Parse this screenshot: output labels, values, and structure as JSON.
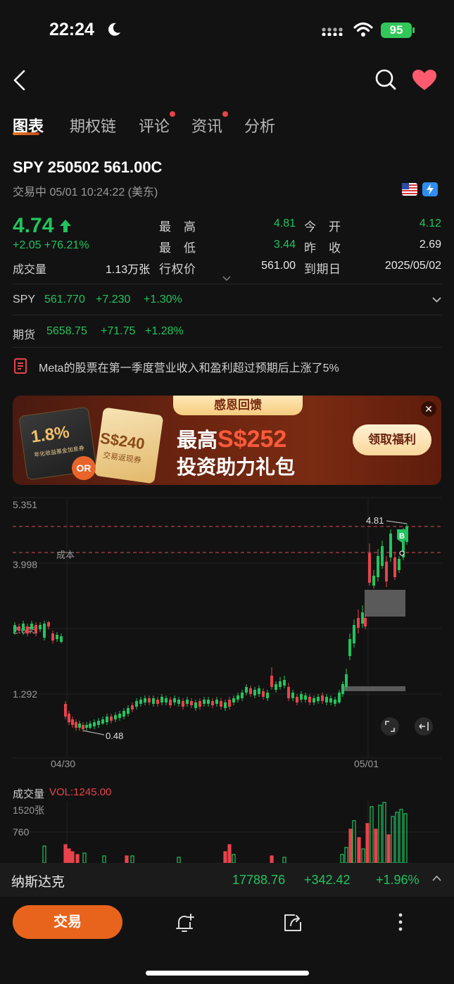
{
  "status_bar": {
    "time": "22:24",
    "battery": "95"
  },
  "tabs": [
    {
      "label": "图表",
      "active": true,
      "dot": false
    },
    {
      "label": "期权链",
      "active": false,
      "dot": false
    },
    {
      "label": "评论",
      "active": false,
      "dot": true
    },
    {
      "label": "资讯",
      "active": false,
      "dot": true
    },
    {
      "label": "分析",
      "active": false,
      "dot": false
    }
  ],
  "header": {
    "symbol": "SPY 250502 561.00C",
    "trade_status": "交易中 05/01 10:24:22 (美东)",
    "price": "4.74",
    "change": "+2.05 +76.21%",
    "volume_label": "成交量",
    "volume_value": "1.13万张"
  },
  "stats": {
    "high_label": "最　高",
    "high": "4.81",
    "open_label": "今　开",
    "open": "4.12",
    "low_label": "最　低",
    "low": "3.44",
    "prev_close_label": "昨　收",
    "prev_close": "2.69",
    "strike_label": "行权价",
    "strike": "561.00",
    "expiry_label": "到期日",
    "expiry": "2025/05/02"
  },
  "underlying": {
    "label": "SPY",
    "price": "561.770",
    "change": "+7.230",
    "pct": "+1.30%"
  },
  "futures": {
    "label": "期货",
    "price": "5658.75",
    "change": "+71.75",
    "pct": "+1.28%"
  },
  "news": {
    "text": "Meta的股票在第一季度营业收入和盈利超过预期后上涨了5%"
  },
  "banner": {
    "ribbon": "感恩回馈",
    "title_prefix": "最高",
    "title_amount": "S$252",
    "subtitle": "投资助力礼包",
    "cta": "领取福利",
    "coupon1_rate": "1.8%",
    "coupon1_sub": "年化收益基金加息券",
    "coupon_or": "OR",
    "coupon2_amount": "S$240",
    "coupon2_sub": "交易返现券"
  },
  "chart_data": {
    "type": "candlestick",
    "y_ticks": [
      "5.351",
      "3.998",
      "2.645",
      "1.292"
    ],
    "x_ticks": [
      "04/30",
      "05/01"
    ],
    "cost_label": "成本",
    "high_marker": "4.81",
    "low_marker": "0.48",
    "buy_marker": "B",
    "ylim": [
      0.3,
      5.6
    ]
  },
  "volume_chart": {
    "title": "成交量",
    "vol_label": "VOL:1245.00",
    "y_ticks": [
      "1520张",
      "760"
    ]
  },
  "ticker": {
    "name": "纳斯达克",
    "value": "17788.76",
    "change": "+342.42",
    "pct": "+1.96%"
  },
  "bottom": {
    "trade_button": "交易"
  },
  "colors": {
    "up": "#22c35e",
    "down": "#e8434c",
    "accent": "#e8641c"
  }
}
